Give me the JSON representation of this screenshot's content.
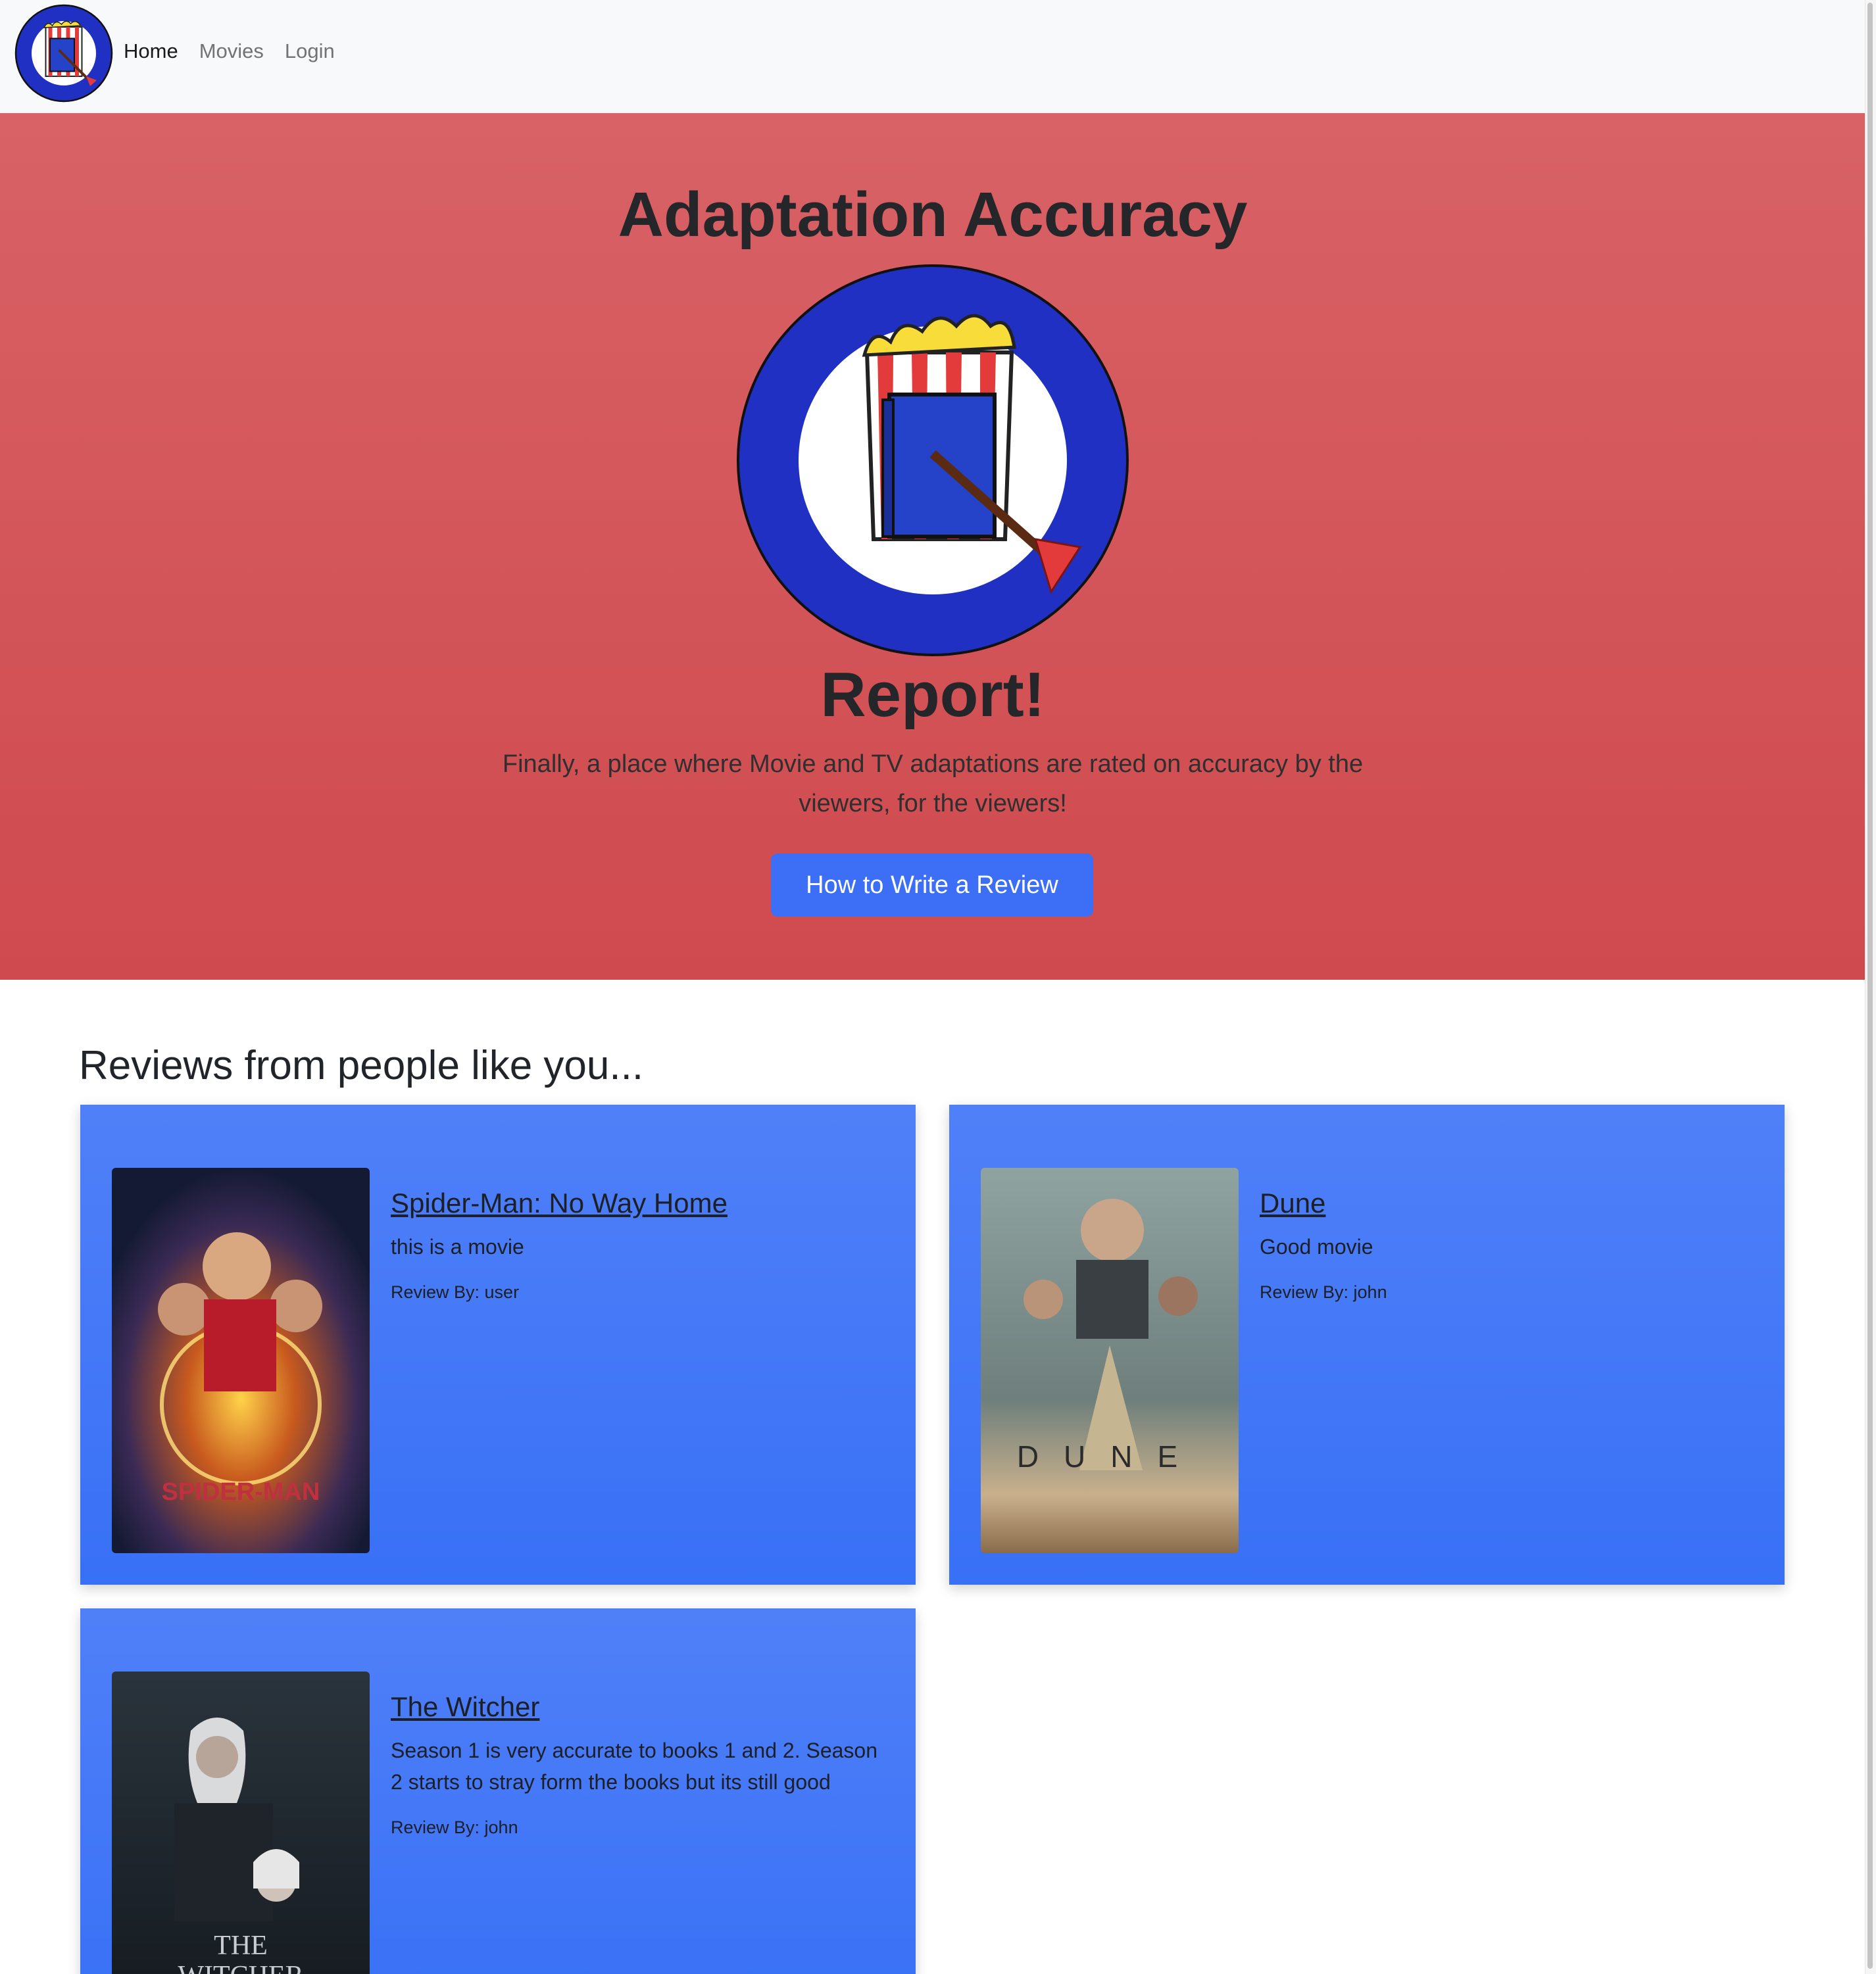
{
  "navbar": {
    "links": [
      {
        "label": "Home"
      },
      {
        "label": "Movies"
      },
      {
        "label": "Login"
      }
    ]
  },
  "hero": {
    "title": "Adaptation Accuracy",
    "report": "Report!",
    "lead": "Finally, a place where Movie and TV adaptations are rated on accuracy by the viewers, for the viewers!",
    "button_label": "How to Write a Review"
  },
  "reviews": {
    "heading": "Reviews from people like you...",
    "items": [
      {
        "title": "Spider-Man: No Way Home",
        "text": "this is a movie",
        "author": "Review By: user",
        "poster_lettering": "SPIDER-MAN"
      },
      {
        "title": "Dune",
        "text": "Good movie",
        "author": "Review By: john",
        "poster_lettering": "DUNE"
      },
      {
        "title": "The Witcher",
        "text": "Season 1 is very accurate to books 1 and 2. Season 2 starts to stray form the books but its still good",
        "author": "Review By: john",
        "poster_lettering": "THE WITCHER"
      }
    ]
  },
  "colors": {
    "navbar_bg": "#f8f9fa",
    "hero_bg": "#d45458",
    "button_bg": "#3c6ef6",
    "card_bg": "#4378f7",
    "logo_ring": "#1f30c2"
  }
}
